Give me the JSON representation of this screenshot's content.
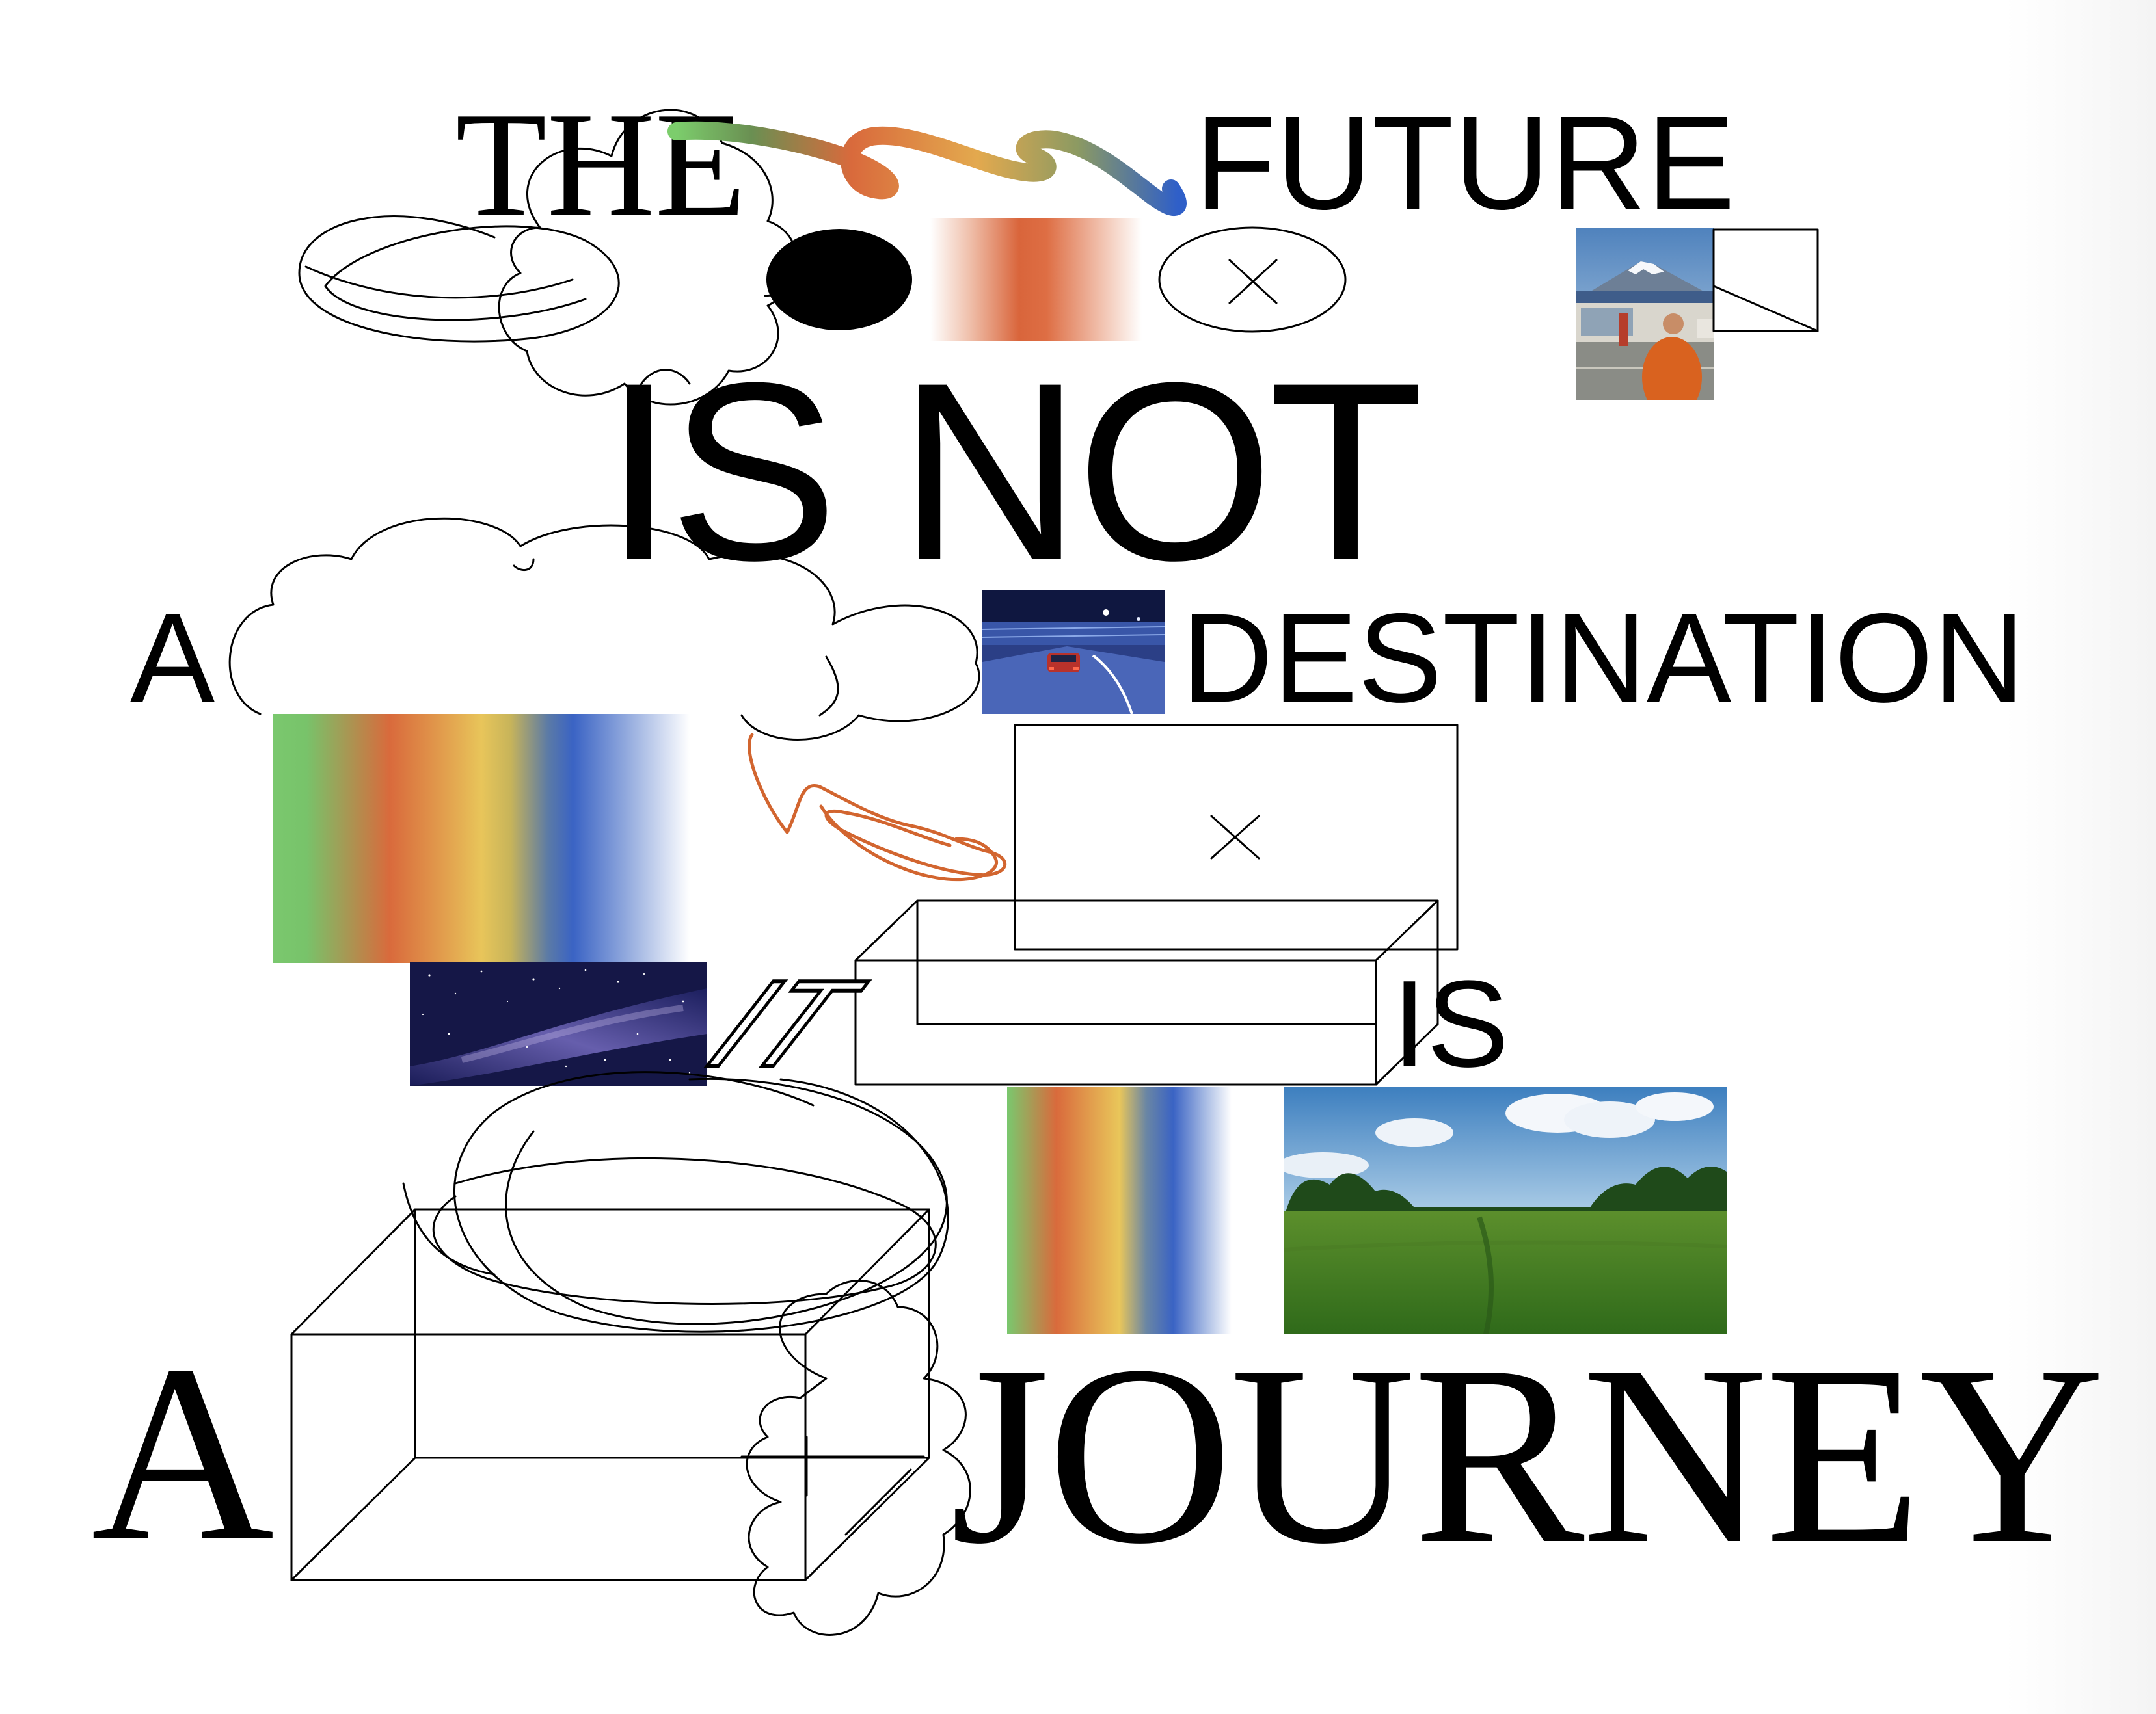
{
  "headline": {
    "the": "THE",
    "future": "FUTURE",
    "is_not": "IS NOT",
    "a_first": "A",
    "destination": "DESTINATION",
    "it": "IT",
    "is": "IS",
    "a_second": "A",
    "journey": "JOURNEY"
  },
  "colors": {
    "ink": "#000000",
    "background": "#ffffff",
    "scribble_orange": "#d2652f",
    "gradient_green": "#7ac86e",
    "gradient_orange": "#d96a3c",
    "gradient_yellow": "#e8c55a",
    "gradient_blue": "#3a63c4"
  },
  "icons": [
    "close-x-icon",
    "close-x-icon"
  ],
  "images": [
    "photo-mount-fuji-street",
    "photo-night-road-car",
    "photo-milky-way",
    "photo-green-field"
  ]
}
